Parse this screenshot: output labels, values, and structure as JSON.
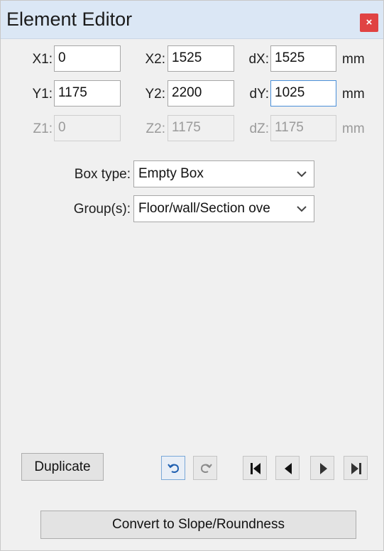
{
  "window": {
    "title": "Element Editor",
    "close_glyph": "×"
  },
  "coords": {
    "x1": {
      "label": "X1:",
      "value": "0"
    },
    "x2": {
      "label": "X2:",
      "value": "1525"
    },
    "dx": {
      "label": "dX:",
      "value": "1525"
    },
    "x_unit": "mm",
    "y1": {
      "label": "Y1:",
      "value": "1175"
    },
    "y2": {
      "label": "Y2:",
      "value": "2200"
    },
    "dy": {
      "label": "dY:",
      "value": "1025"
    },
    "y_unit": "mm",
    "z1": {
      "label": "Z1:",
      "value": "0"
    },
    "z2": {
      "label": "Z2:",
      "value": "1175"
    },
    "dz": {
      "label": "dZ:",
      "value": "1175"
    },
    "z_unit": "mm"
  },
  "box_type": {
    "label": "Box type:",
    "value": "Empty Box"
  },
  "groups": {
    "label": "Group(s):",
    "value": "Floor/wall/Section ove"
  },
  "buttons": {
    "duplicate": "Duplicate",
    "convert": "Convert to Slope/Roundness"
  },
  "icons": [
    "undo-icon",
    "redo-icon",
    "first-icon",
    "previous-icon",
    "next-icon",
    "last-icon"
  ],
  "colors": {
    "titlebar": "#dbe7f5",
    "close": "#e04343",
    "focus_border": "#4a8fd8"
  }
}
